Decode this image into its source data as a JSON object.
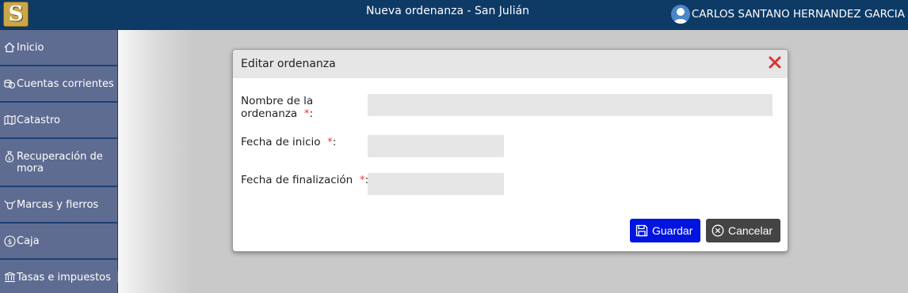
{
  "header": {
    "logo_letter": "S",
    "title": "Nueva ordenanza - San Julián",
    "user_name": "CARLOS SANTANO HERNANDEZ GARCIA"
  },
  "sidebar": {
    "items": [
      {
        "label": "Inicio",
        "icon": "home-icon"
      },
      {
        "label": "Cuentas corrientes",
        "icon": "coins-icon"
      },
      {
        "label": "Catastro",
        "icon": "map-icon"
      },
      {
        "label": "Recuperación de mora",
        "icon": "money-bag-icon"
      },
      {
        "label": "Marcas y fierros",
        "icon": "bull-icon"
      },
      {
        "label": "Caja",
        "icon": "dollar-circle-icon"
      },
      {
        "label": "Tasas e impuestos",
        "icon": "bank-icon"
      }
    ],
    "active": "Tasas e impuestos"
  },
  "modal": {
    "title": "Editar ordenanza",
    "fields": [
      {
        "label_line1": "Nombre de la",
        "label_line2": "ordenanza",
        "required_mark": "*",
        "suffix": ":",
        "value": ""
      },
      {
        "label": "Fecha de inicio",
        "required_mark": "*",
        "suffix": ":",
        "value": ""
      },
      {
        "label": "Fecha de finalización",
        "required_mark": "*",
        "suffix": ":",
        "value": ""
      }
    ],
    "save_label": "Guardar",
    "cancel_label": "Cancelar"
  },
  "colors": {
    "topbar": "#0e3a66",
    "sidebar_item": "#5f6c91",
    "save_button": "#0014e0",
    "cancel_button": "#444444",
    "required": "#e04040",
    "close": "#e03030"
  }
}
